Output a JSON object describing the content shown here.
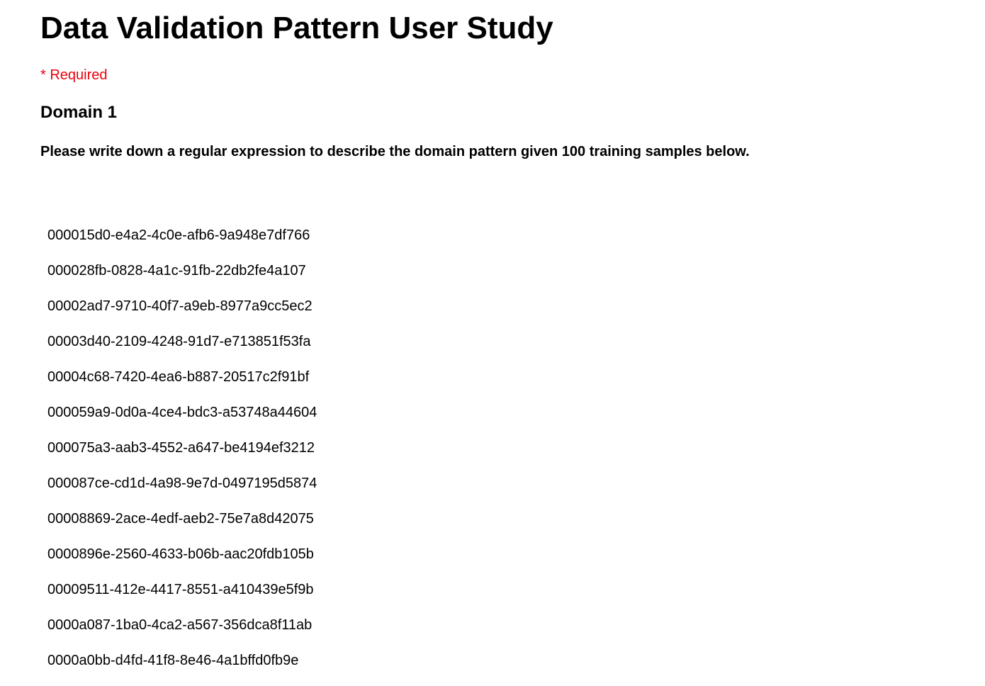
{
  "page": {
    "title": "Data Validation Pattern User Study",
    "required_note": "* Required"
  },
  "section": {
    "heading": "Domain 1",
    "question": "Please write down a regular expression to describe the domain pattern given 100 training samples below."
  },
  "samples": [
    "000015d0-e4a2-4c0e-afb6-9a948e7df766",
    "000028fb-0828-4a1c-91fb-22db2fe4a107",
    "00002ad7-9710-40f7-a9eb-8977a9cc5ec2",
    "00003d40-2109-4248-91d7-e713851f53fa",
    "00004c68-7420-4ea6-b887-20517c2f91bf",
    "000059a9-0d0a-4ce4-bdc3-a53748a44604",
    "000075a3-aab3-4552-a647-be4194ef3212",
    "000087ce-cd1d-4a98-9e7d-0497195d5874",
    "00008869-2ace-4edf-aeb2-75e7a8d42075",
    "0000896e-2560-4633-b06b-aac20fdb105b",
    "00009511-412e-4417-8551-a410439e5f9b",
    "0000a087-1ba0-4ca2-a567-356dca8f11ab",
    "0000a0bb-d4fd-41f8-8e46-4a1bffd0fb9e"
  ],
  "colors": {
    "required": "#e8000b",
    "text": "#000000",
    "background": "#ffffff"
  }
}
